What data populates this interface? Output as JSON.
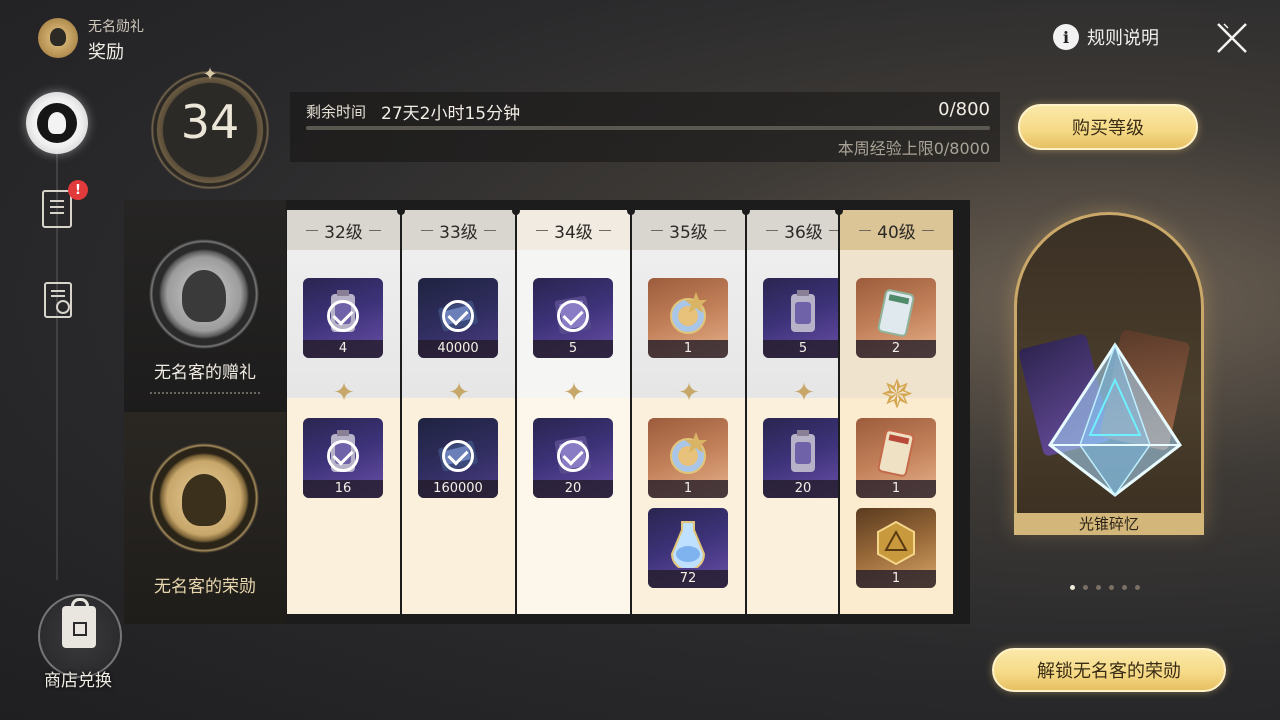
{
  "header": {
    "subtitle": "无名勋礼",
    "title": "奖励",
    "rules_label": "规则说明"
  },
  "nav": {
    "missions_badge": "!",
    "shop_label": "商店兑换"
  },
  "level": {
    "current": "34"
  },
  "exp": {
    "time_label": "剩余时间",
    "time_value": "27天2小时15分钟",
    "value": "0/800",
    "progress": 0,
    "weekly_limit": "本周经验上限0/8000"
  },
  "buy_label": "购买等级",
  "tracks": {
    "free_label": "无名客的赠礼",
    "paid_label": "无名客的荣勋"
  },
  "columns": [
    {
      "level": "32级",
      "free": [
        {
          "count": "4",
          "claimed": true,
          "icon": "trace-material-icon"
        }
      ],
      "paid": [
        {
          "count": "16",
          "claimed": true,
          "icon": "trace-material-icon"
        }
      ]
    },
    {
      "level": "33级",
      "free": [
        {
          "count": "40000",
          "claimed": true,
          "icon": "credit-icon"
        }
      ],
      "paid": [
        {
          "count": "160000",
          "claimed": true,
          "icon": "credit-icon"
        }
      ]
    },
    {
      "level": "34级",
      "free": [
        {
          "count": "5",
          "claimed": true,
          "icon": "exp-book-icon"
        }
      ],
      "paid": [
        {
          "count": "20",
          "claimed": true,
          "icon": "exp-book-icon"
        }
      ]
    },
    {
      "level": "35级",
      "free": [
        {
          "count": "1",
          "claimed": false,
          "icon": "star-orb-icon"
        }
      ],
      "paid": [
        {
          "count": "1",
          "claimed": false,
          "icon": "star-orb-icon"
        },
        {
          "count": "72",
          "claimed": false,
          "icon": "fuel-flask-icon"
        }
      ]
    },
    {
      "level": "36级",
      "free": [
        {
          "count": "5",
          "claimed": false,
          "icon": "trace-material-icon"
        }
      ],
      "paid": [
        {
          "count": "20",
          "claimed": false,
          "icon": "trace-material-icon"
        }
      ]
    },
    {
      "level": "40级",
      "free": [
        {
          "count": "2",
          "claimed": false,
          "icon": "pass-ticket-icon"
        }
      ],
      "paid": [
        {
          "count": "1",
          "claimed": false,
          "icon": "special-pass-icon"
        },
        {
          "count": "1",
          "claimed": false,
          "icon": "gold-cube-icon"
        }
      ]
    }
  ],
  "showcase": {
    "caption": "光锥碎忆",
    "page_count": 6,
    "active_page": 1
  },
  "unlock_label": "解锁无名客的荣勋"
}
